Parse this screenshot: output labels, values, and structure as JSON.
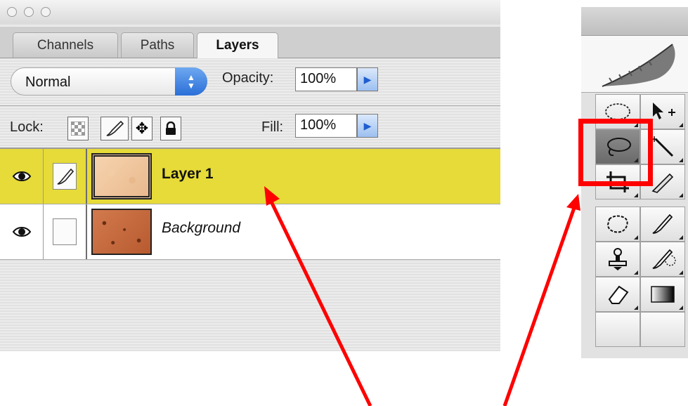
{
  "window": {
    "traffic_lights": [
      "close-button",
      "minimize-button",
      "zoom-button"
    ]
  },
  "tabs": [
    {
      "label": "Channels",
      "active": false
    },
    {
      "label": "Paths",
      "active": false
    },
    {
      "label": "Layers",
      "active": true
    }
  ],
  "controls": {
    "blend_mode": "Normal",
    "opacity_label": "Opacity:",
    "opacity_value": "100%",
    "lock_label": "Lock:",
    "fill_label": "Fill:",
    "fill_value": "100%"
  },
  "layers": [
    {
      "name": "Layer 1",
      "selected": true,
      "visible": true,
      "italic": false
    },
    {
      "name": "Background",
      "selected": false,
      "visible": true,
      "italic": true
    }
  ],
  "toolbox": {
    "tools": [
      "marquee-tool",
      "move-tool",
      "lasso-tool",
      "magic-wand-tool",
      "crop-tool",
      "slice-tool",
      "healing-brush-tool",
      "brush-tool",
      "clone-stamp-tool",
      "history-brush-tool",
      "eraser-tool",
      "gradient-tool"
    ],
    "highlighted_tool": "lasso-tool"
  },
  "colors": {
    "selected_row": "#e6db38",
    "annotation": "#ff0000",
    "accent_blue": "#2a6fd8"
  }
}
